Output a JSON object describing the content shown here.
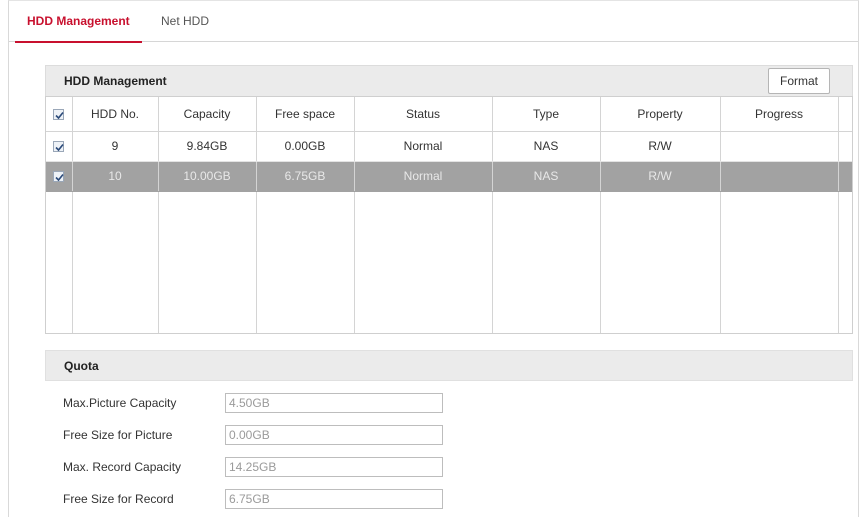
{
  "tabs": [
    {
      "label": "HDD Management",
      "active": true
    },
    {
      "label": "Net HDD",
      "active": false
    }
  ],
  "hdd_panel": {
    "title": "HDD Management",
    "format_label": "Format",
    "columns": [
      "HDD No.",
      "Capacity",
      "Free space",
      "Status",
      "Type",
      "Property",
      "Progress"
    ],
    "rows": [
      {
        "checked": true,
        "selected": false,
        "hdd_no": "9",
        "capacity": "9.84GB",
        "free_space": "0.00GB",
        "status": "Normal",
        "type": "NAS",
        "property": "R/W",
        "progress": ""
      },
      {
        "checked": true,
        "selected": true,
        "hdd_no": "10",
        "capacity": "10.00GB",
        "free_space": "6.75GB",
        "status": "Normal",
        "type": "NAS",
        "property": "R/W",
        "progress": ""
      }
    ]
  },
  "quota": {
    "title": "Quota",
    "fields": [
      {
        "label": "Max.Picture Capacity",
        "value": "4.50GB"
      },
      {
        "label": "Free Size for Picture",
        "value": "0.00GB"
      },
      {
        "label": "Max. Record Capacity",
        "value": "14.25GB"
      },
      {
        "label": "Free Size for Record",
        "value": "6.75GB"
      }
    ]
  },
  "colors": {
    "accent": "#c8102e",
    "selected_row": "#a2a2a2",
    "panel_header": "#ebebeb"
  }
}
